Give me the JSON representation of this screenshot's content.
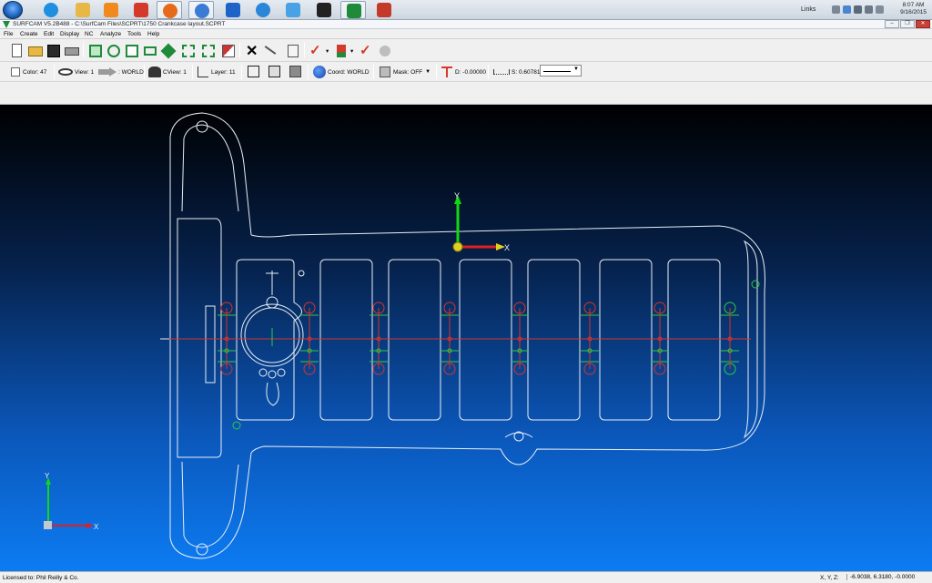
{
  "taskbar": {
    "apps": [
      {
        "name": "windows-start",
        "color": "#2f7ad6"
      },
      {
        "name": "internet-explorer",
        "color": "#1f8fe0"
      },
      {
        "name": "file-explorer",
        "color": "#e8b846"
      },
      {
        "name": "media-player",
        "color": "#f08a1e"
      },
      {
        "name": "solidworks",
        "color": "#d43a2a"
      },
      {
        "name": "firefox",
        "color": "#e56a1b"
      },
      {
        "name": "browser-blue",
        "color": "#3a7bd5"
      },
      {
        "name": "app-6",
        "color": "#1e63c7"
      },
      {
        "name": "app-blue-globe",
        "color": "#2a86d8"
      },
      {
        "name": "app-windows-logo",
        "color": "#4aa2e6"
      },
      {
        "name": "app-dark",
        "color": "#222222"
      },
      {
        "name": "surfcam",
        "color": "#1f8a3a"
      },
      {
        "name": "app-image",
        "color": "#c33a2a"
      }
    ],
    "tray_links": "Links",
    "clock_time": "8:07 AM",
    "clock_date": "9/16/2015"
  },
  "window": {
    "title": "SURFCAM V5.2B488 - C:\\SurfCam Files\\SCPRT\\1750 Crankcase layout.SCPRT"
  },
  "menu": [
    "File",
    "Create",
    "Edit",
    "Display",
    "NC",
    "Analyze",
    "Tools",
    "Help"
  ],
  "toolbar2": {
    "color": "Color: 47",
    "view": "View: 1",
    "world": ": WORLD",
    "cview": "CView: 1",
    "layer": "Layer: 11",
    "coord": "Coord: WORLD",
    "mask": "Mask: OFF",
    "depth": "D: -0.00000",
    "spacing": "S: 0.60781"
  },
  "status": {
    "license": "Licensed to: Phil Reilly & Co.",
    "xyz_label": "X, Y, Z:",
    "xyz_value": "-6.9038, 6.3180, -0.0000"
  },
  "axis_labels": {
    "x": "X",
    "y": "Y"
  },
  "colors": {
    "outline": "#e9eef5",
    "red": "#d8332d",
    "green": "#2ecc40",
    "axis_green": "#12d812",
    "axis_red": "#e02020",
    "yellow": "#e0d020"
  }
}
